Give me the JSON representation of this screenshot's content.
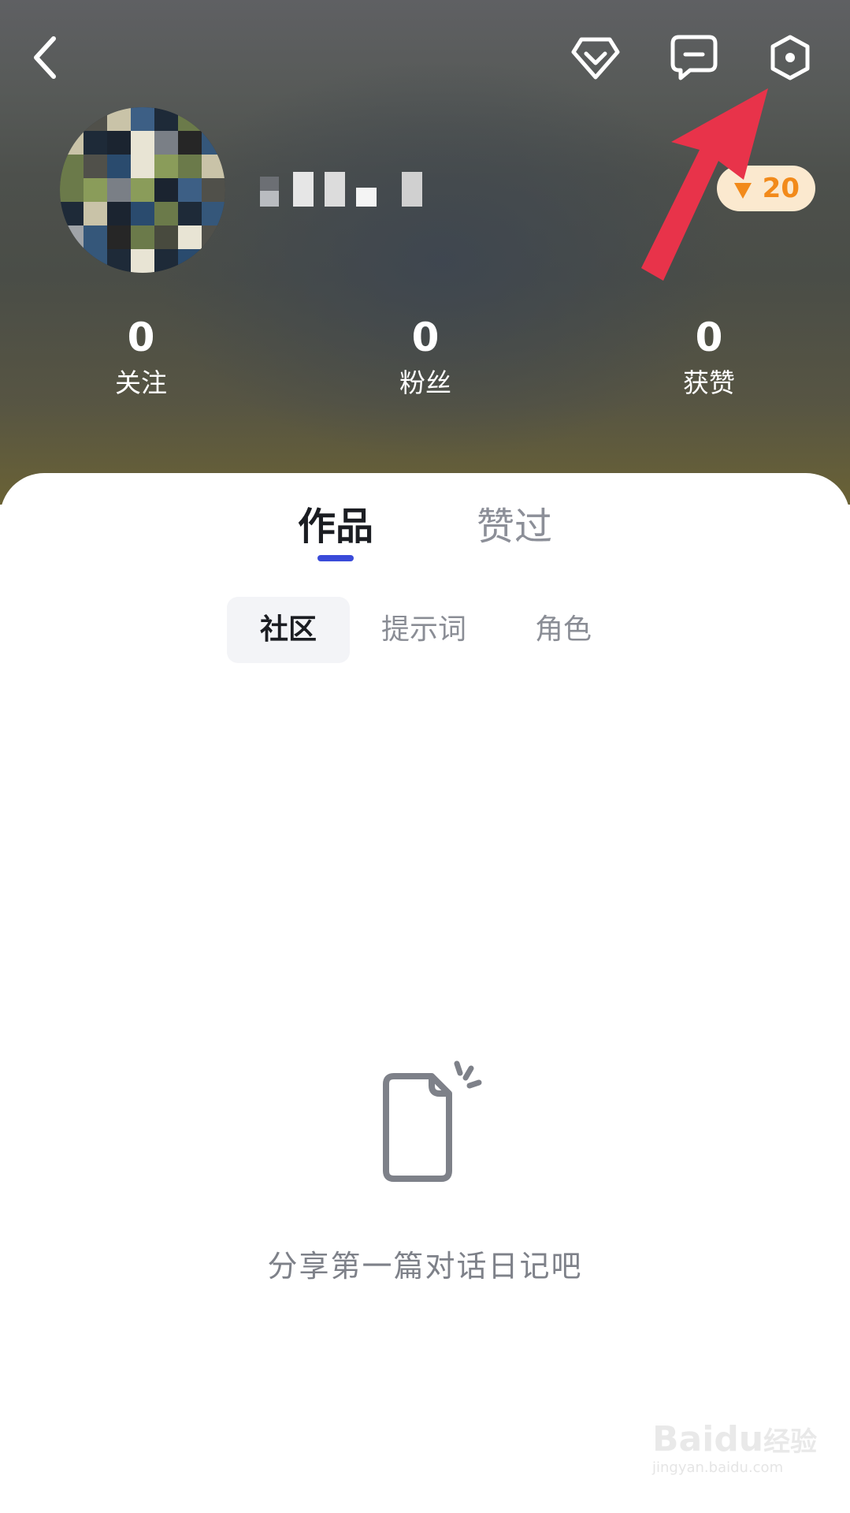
{
  "header": {
    "back_icon": "back-chevron-icon",
    "actions": [
      {
        "name": "vip-diamond-icon"
      },
      {
        "name": "message-icon"
      },
      {
        "name": "settings-icon"
      }
    ],
    "badge": {
      "value": "20",
      "icon": "coin-icon",
      "color": "#f28a1a"
    }
  },
  "stats": [
    {
      "value": "0",
      "label": "关注"
    },
    {
      "value": "0",
      "label": "粉丝"
    },
    {
      "value": "0",
      "label": "获赞"
    }
  ],
  "tabs": [
    {
      "label": "作品",
      "active": true
    },
    {
      "label": "赞过",
      "active": false
    }
  ],
  "subtabs": [
    {
      "label": "社区",
      "active": true
    },
    {
      "label": "提示词",
      "active": false
    },
    {
      "label": "角色",
      "active": false
    }
  ],
  "empty_state": {
    "icon": "document-icon",
    "text": "分享第一篇对话日记吧"
  },
  "watermark": {
    "logo": "Bai",
    "logo_paw": "du",
    "text": "经验",
    "url": "jingyan.baidu.com"
  },
  "colors": {
    "accent": "#3a4bd9",
    "annotation_arrow": "#e8334a"
  }
}
